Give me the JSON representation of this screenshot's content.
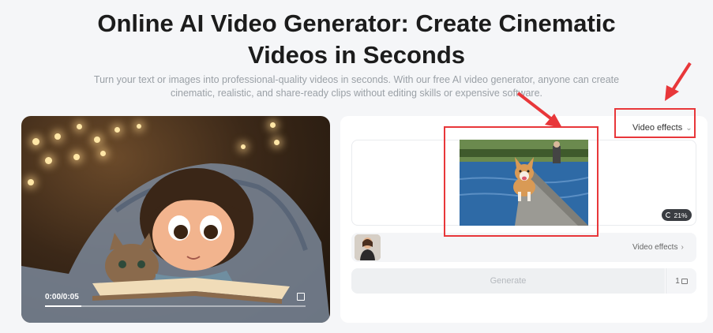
{
  "hero": {
    "title_line1": "Online AI Video Generator: Create Cinematic",
    "title_line2": "Videos in Seconds",
    "subtitle": "Turn your text or images into professional-quality videos in seconds. With our free AI video generator, anyone can create cinematic, realistic, and share-ready clips without editing skills or expensive software."
  },
  "player": {
    "time": "0:00/0:05",
    "progress": 0.14
  },
  "panel": {
    "effects_dropdown_label": "Video effects",
    "progress_badge": "21%",
    "reference_effects_label": "Video effects",
    "generate_label": "Generate",
    "credits": "1"
  },
  "annotation": {
    "highlight_color": "#e8373a"
  }
}
